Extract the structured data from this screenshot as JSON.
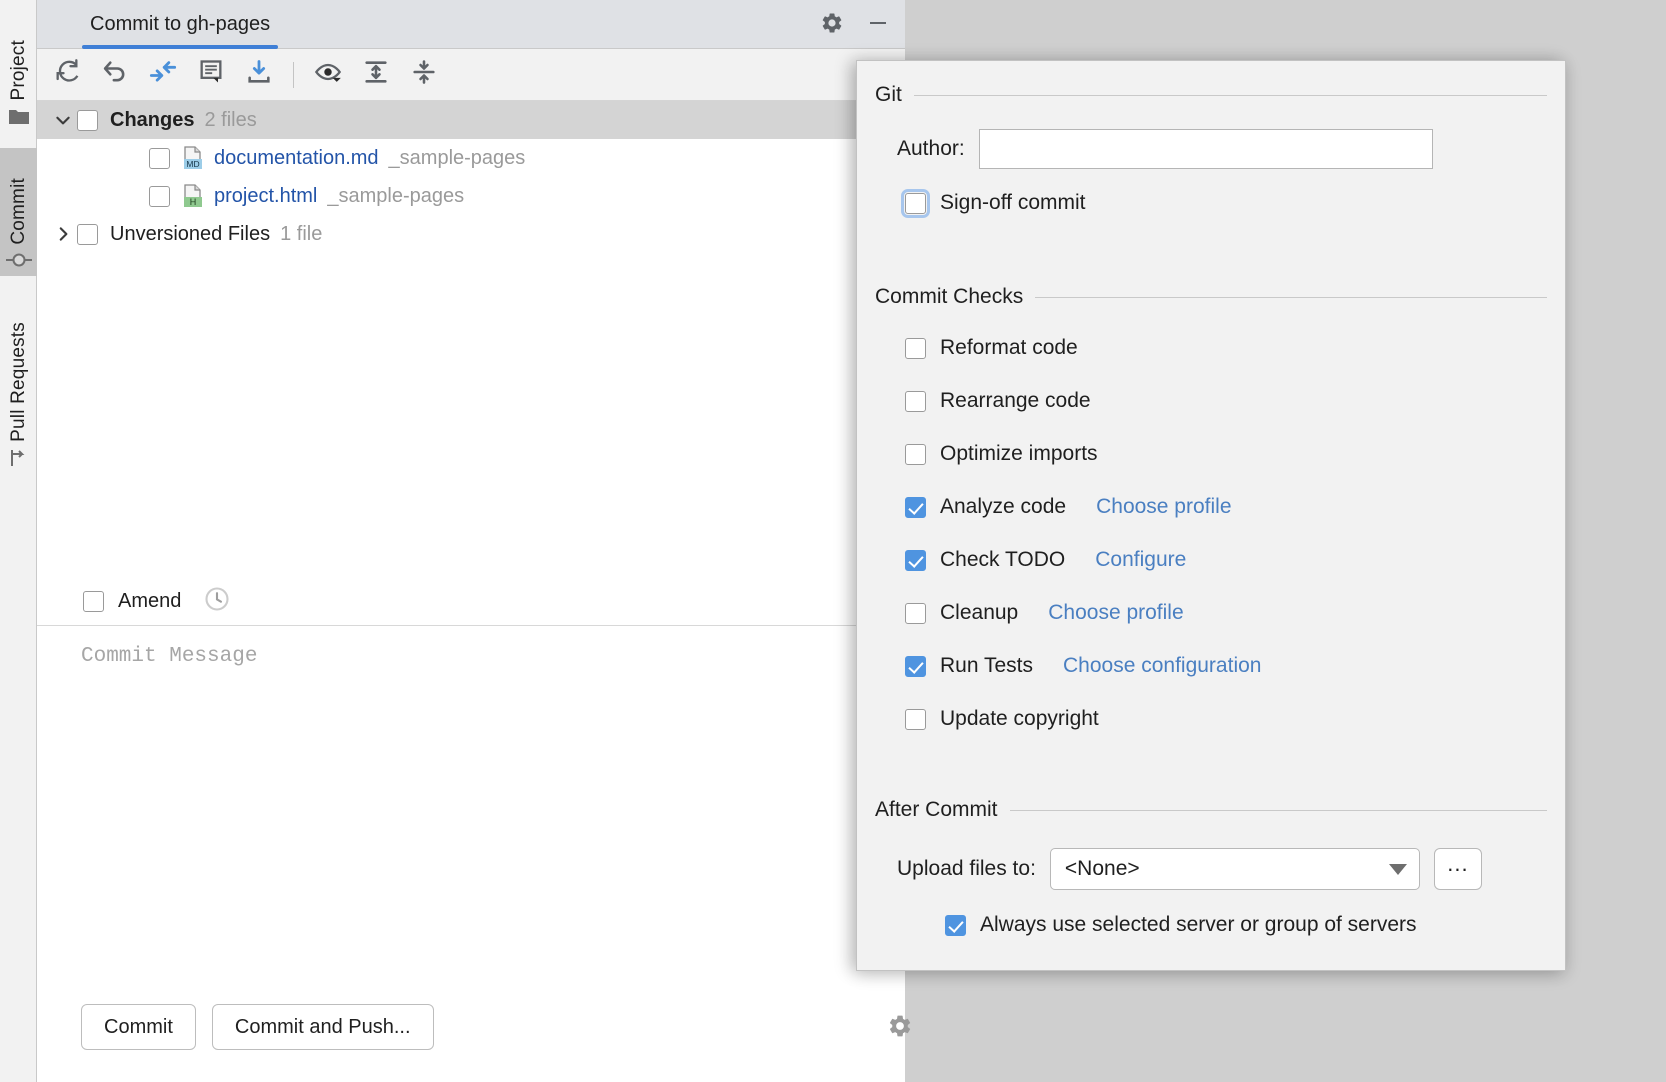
{
  "toolwindow_tabs": [
    {
      "label": "Project",
      "icon": "folder-icon"
    },
    {
      "label": "Commit",
      "icon": "commit-node-icon"
    },
    {
      "label": "Pull Requests",
      "icon": "pull-request-icon"
    }
  ],
  "panel": {
    "tab_title": "Commit to gh-pages",
    "gear_icon": "gear-icon",
    "minimize_icon": "minimize-icon"
  },
  "toolbar": {
    "buttons": [
      {
        "name": "refresh-changes",
        "icon": "refresh-icon"
      },
      {
        "name": "rollback",
        "icon": "undo-icon"
      },
      {
        "name": "show-diff",
        "icon": "diff-arrows-icon"
      },
      {
        "name": "edit-changelist",
        "icon": "note-icon"
      },
      {
        "name": "shelve-changes",
        "icon": "download-icon"
      },
      {
        "name": "preview-diff",
        "icon": "eye-icon"
      },
      {
        "name": "expand-all",
        "icon": "expand-all-icon"
      },
      {
        "name": "collapse-all",
        "icon": "collapse-all-icon"
      }
    ]
  },
  "changes_tree": {
    "group": {
      "label": "Changes",
      "count": "2 files",
      "expanded": true,
      "checked": false
    },
    "files": [
      {
        "name": "documentation.md",
        "path": "_sample-pages",
        "icon": "markdown-file-icon",
        "badge": "MD",
        "badge_color": "#9ccde8",
        "checked": false
      },
      {
        "name": "project.html",
        "path": "_sample-pages",
        "icon": "html-file-icon",
        "badge": "H",
        "badge_color": "#8fc98f",
        "checked": false
      }
    ],
    "unversioned": {
      "label": "Unversioned Files",
      "count": "1 file",
      "expanded": false,
      "checked": false
    }
  },
  "amend": {
    "label": "Amend",
    "checked": false,
    "history_icon": "clock-icon"
  },
  "commit_message": {
    "placeholder": "Commit Message",
    "value": ""
  },
  "actions": {
    "commit_label": "Commit",
    "commit_and_push_label": "Commit and Push...",
    "bottom_gear_icon": "gear-icon"
  },
  "popup": {
    "git_section": {
      "title": "Git",
      "author_label": "Author:",
      "author_value": "",
      "author_placeholder": "",
      "signoff": {
        "label": "Sign-off commit",
        "checked": false,
        "focused": true
      }
    },
    "commit_checks": {
      "title": "Commit Checks",
      "items": [
        {
          "label": "Reformat code",
          "checked": false,
          "link": ""
        },
        {
          "label": "Rearrange code",
          "checked": false,
          "link": ""
        },
        {
          "label": "Optimize imports",
          "checked": false,
          "link": ""
        },
        {
          "label": "Analyze code",
          "checked": true,
          "link": "Choose profile"
        },
        {
          "label": "Check TODO",
          "checked": true,
          "link": "Configure"
        },
        {
          "label": "Cleanup",
          "checked": false,
          "link": "Choose profile"
        },
        {
          "label": "Run Tests",
          "checked": true,
          "link": "Choose configuration"
        },
        {
          "label": "Update copyright",
          "checked": false,
          "link": ""
        }
      ]
    },
    "after_commit": {
      "title": "After Commit",
      "upload_label": "Upload files to:",
      "upload_value": "<None>",
      "browse_label": "...",
      "always_use": {
        "label": "Always use selected server or group of servers",
        "checked": true
      }
    }
  },
  "colors": {
    "accent_blue": "#3f7fd6",
    "link_blue": "#4a7fc1",
    "checkbox_blue": "#4f94e0",
    "file_link": "#2354a8",
    "muted_text": "#9a9a9a"
  }
}
